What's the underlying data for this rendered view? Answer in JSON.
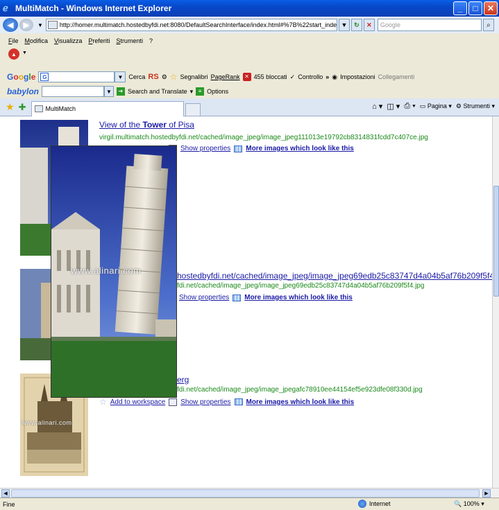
{
  "window": {
    "title": "MultiMatch - Windows Internet Explorer"
  },
  "address_bar": {
    "url": "http://homer.multimatch.hostedbyfdi.net:8080/DefaultSearchInterface/index.html#%7B%22start_index%2",
    "search_placeholder": "Google"
  },
  "menu": {
    "items": [
      "File",
      "Modifica",
      "Visualizza",
      "Preferiti",
      "Strumenti",
      "?"
    ]
  },
  "google_toolbar": {
    "logo": "Google",
    "search_label": "Cerca",
    "rs_label": "RS",
    "bookmarks_label": "Segnalibri",
    "pagerank_label": "PageRank",
    "blocked_label": "455 bloccati",
    "check_label": "Controllo",
    "more_label": "»",
    "settings_label": "Impostazioni",
    "links_label": "Collegamenti"
  },
  "babylon_toolbar": {
    "logo": "babylon",
    "search_translate_label": "Search and Translate",
    "options_label": "Options"
  },
  "tabs": {
    "active_label": "MultiMatch"
  },
  "command_bar": {
    "page_label": "Pagina",
    "tools_label": "Strumenti"
  },
  "results": [
    {
      "title_prefix": "View of the ",
      "title_bold": "Tower",
      "title_suffix": " of Pisa",
      "url": "virgil.multimatch.hostedbyfdi.net/cached/image_jpeg/image_jpeg111013e19792cb8314831fcdd7c407ce.jpg",
      "show_properties": "Show properties",
      "more_images": "More images which look like this"
    },
    {
      "title": "hostedbyfdi.net/cached/image_jpeg/image_jpeg69edb25c83747d4a04b5af76b209f5f4.jpg",
      "url": "fdi.net/cached/image_jpeg/image_jpeg69edb25c83747d4a04b5af76b209f5f4.jpg",
      "show_properties": "Show properties",
      "more_images": "More images which look like this"
    },
    {
      "title": "erg",
      "url": "fdi.net/cached/image_jpeg/image_jpegafc78910ee44154ef5e923dfe08f330d.jpg",
      "add_workspace": "Add to workspace",
      "show_properties": "Show properties",
      "more_images": "More images which look like this"
    }
  ],
  "overlay": {
    "watermark": "www.alinari.com"
  },
  "thumb_watermark": "www.alinari.com",
  "status_bar": {
    "status": "Fine",
    "zone": "Internet",
    "zoom": "100%"
  }
}
